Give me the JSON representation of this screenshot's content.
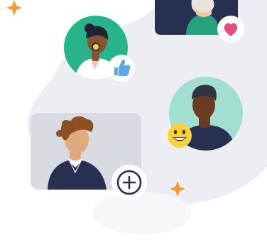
{
  "illustration": {
    "people": [
      {
        "name": "woman-with-glasses",
        "badge": "heart-icon"
      },
      {
        "name": "woman-with-headset",
        "badge": "thumbs-up-icon"
      },
      {
        "name": "man-dark-skin",
        "badge": "grinning-emoji-icon"
      },
      {
        "name": "man-curly-hair",
        "badge": "add-circle-icon"
      }
    ],
    "colors": {
      "blob": "#eceef4",
      "navy": "#273051",
      "teal": "#27b48a",
      "mint": "#a3dfd0",
      "card_gray": "#d8dbe2",
      "sparkle": "#f39a3a",
      "heart": "#e64c7c",
      "thumb": "#5aa8e8",
      "emoji": "#ffd23a"
    }
  }
}
